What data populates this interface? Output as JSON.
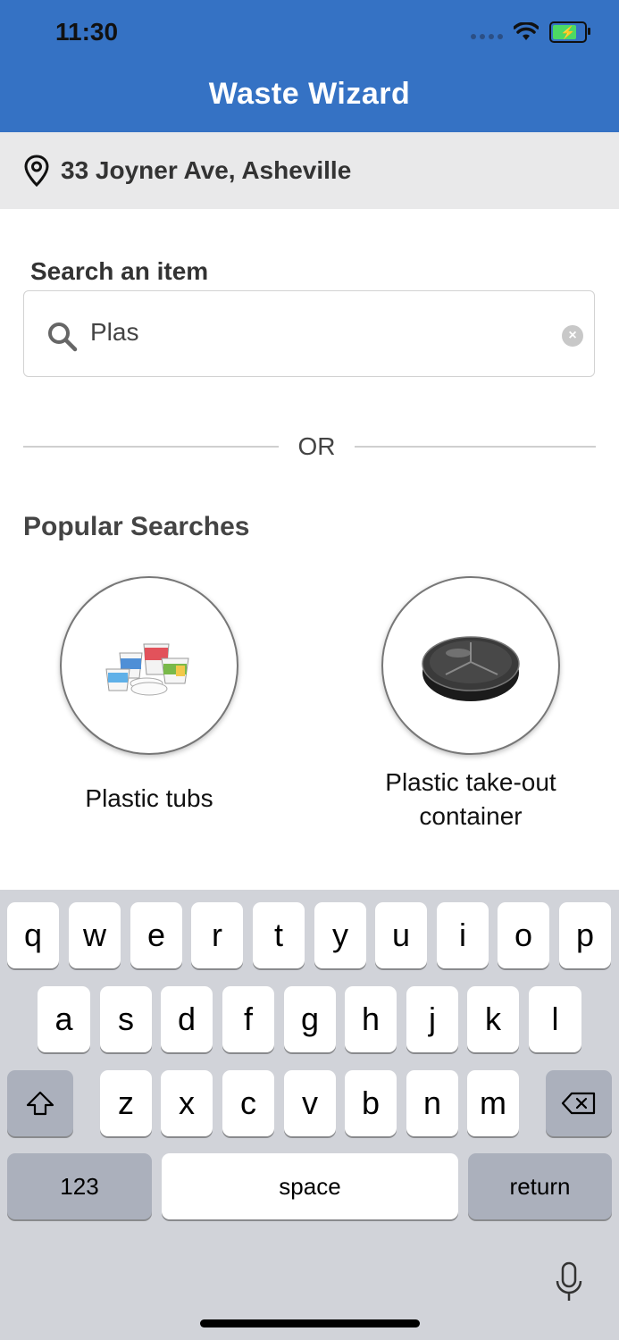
{
  "status_bar": {
    "time": "11:30"
  },
  "header": {
    "title": "Waste Wizard"
  },
  "address": {
    "text": "33 Joyner Ave, Asheville"
  },
  "search": {
    "label": "Search an item",
    "value": "Plas"
  },
  "divider": {
    "text": "OR"
  },
  "popular": {
    "title": "Popular Searches",
    "items": [
      {
        "label": "Plastic tubs",
        "icon": "plastic-tubs-image"
      },
      {
        "label": "Plastic take-out container",
        "icon": "takeout-container-image"
      }
    ]
  },
  "keyboard": {
    "row1": [
      "q",
      "w",
      "e",
      "r",
      "t",
      "y",
      "u",
      "i",
      "o",
      "p"
    ],
    "row2": [
      "a",
      "s",
      "d",
      "f",
      "g",
      "h",
      "j",
      "k",
      "l"
    ],
    "row3": [
      "z",
      "x",
      "c",
      "v",
      "b",
      "n",
      "m"
    ],
    "numbers_label": "123",
    "space_label": "space",
    "return_label": "return"
  },
  "colors": {
    "header_bg": "#3572c4",
    "address_bg": "#e9e9ea",
    "keyboard_bg": "#d1d3d9"
  }
}
